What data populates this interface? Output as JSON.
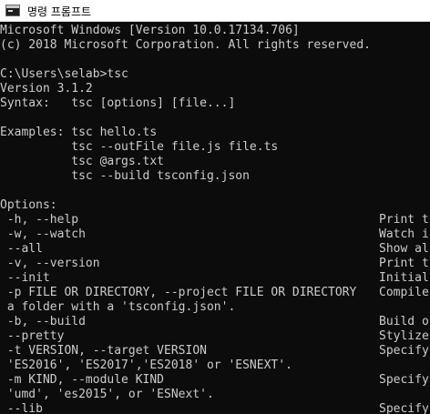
{
  "window": {
    "title": "명령 프롬프트",
    "icon": "command-prompt-icon"
  },
  "colors": {
    "background": "#0c0c0c",
    "text": "#cccccc",
    "titlebar": "#ffffff"
  },
  "console": {
    "lines": [
      "Microsoft Windows [Version 10.0.17134.706]",
      "(c) 2018 Microsoft Corporation. All rights reserved.",
      "",
      "C:\\Users\\selab>tsc",
      "Version 3.1.2",
      "Syntax:   tsc [options] [file...]",
      "",
      "Examples: tsc hello.ts",
      "          tsc --outFile file.js file.ts",
      "          tsc @args.txt",
      "          tsc --build tsconfig.json",
      "",
      "Options:",
      " -h, --help",
      " -w, --watch",
      " --all",
      " -v, --version",
      " --init",
      " -p FILE OR DIRECTORY, --project FILE OR DIRECTORY",
      " a folder with a 'tsconfig.json'.",
      " -b, --build",
      " --pretty",
      " -t VERSION, --target VERSION",
      " 'ES2016', 'ES2017','ES2018' or 'ESNEXT'.",
      " -m KIND, --module KIND",
      " 'umd', 'es2015', or 'ESNext'.",
      " --lib"
    ],
    "descriptions": [
      "Print t",
      "Watch i",
      "Show al",
      "Print t",
      "Initial",
      "Compile",
      "Build o",
      "Stylize",
      "Specify",
      "Specify",
      "Specify"
    ]
  }
}
